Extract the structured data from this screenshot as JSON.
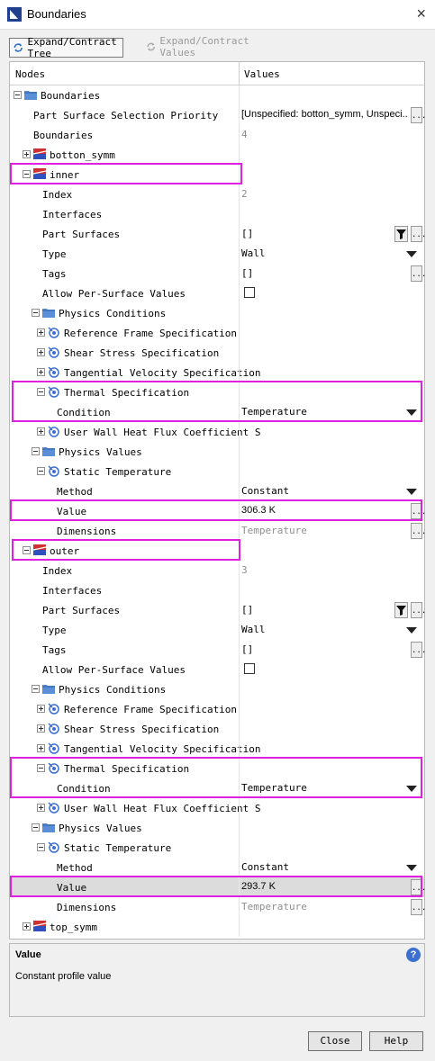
{
  "window": {
    "title": "Boundaries",
    "close_glyph": "×"
  },
  "toolbar": {
    "expand_tree": "Expand/Contract Tree",
    "expand_values": "Expand/Contract Values"
  },
  "columns": {
    "nodes": "Nodes",
    "values": "Values"
  },
  "rows": [
    {
      "name": "Boundaries",
      "value": "",
      "level": 0,
      "expander": "minus",
      "icon": "folder-icon"
    },
    {
      "name": "Part Surface Selection Priority",
      "value": "[Unspecified: botton_symm, Unspeci...",
      "level": 1,
      "value_font": "sans",
      "dots": true
    },
    {
      "name": "Boundaries",
      "value": "4",
      "level": 1,
      "value_color": "gray"
    },
    {
      "name": "botton_symm",
      "value": "",
      "level": 1,
      "expander": "plus",
      "icon": "boundary-icon"
    },
    {
      "name": "inner",
      "value": "",
      "level": 1,
      "expander": "minus",
      "icon": "boundary-icon"
    },
    {
      "name": "Index",
      "value": "2",
      "level": 2,
      "value_color": "gray"
    },
    {
      "name": "Interfaces",
      "value": "",
      "level": 2
    },
    {
      "name": "Part Surfaces",
      "value": "[]",
      "level": 2,
      "filter": true,
      "dots": true
    },
    {
      "name": "Type",
      "value": "Wall",
      "level": 2,
      "dropdown": true
    },
    {
      "name": "Tags",
      "value": "[]",
      "level": 2,
      "dots": true
    },
    {
      "name": "Allow Per-Surface Values",
      "value": "",
      "level": 2,
      "checkbox": true
    },
    {
      "name": "Physics Conditions",
      "value": "",
      "level": 2,
      "expander": "minus",
      "icon": "folder-icon"
    },
    {
      "name": "Reference Frame Specification",
      "value": "",
      "level": 3,
      "expander": "plus",
      "icon": "physics-icon"
    },
    {
      "name": "Shear Stress Specification",
      "value": "",
      "level": 3,
      "expander": "plus",
      "icon": "physics-icon"
    },
    {
      "name": "Tangential Velocity Specification",
      "value": "",
      "level": 3,
      "expander": "plus",
      "icon": "physics-icon"
    },
    {
      "name": "Thermal Specification",
      "value": "",
      "level": 3,
      "expander": "minus",
      "icon": "physics-icon"
    },
    {
      "name": "Condition",
      "value": "Temperature",
      "level": 4,
      "dropdown": true
    },
    {
      "name": "User Wall Heat Flux Coefficient S",
      "value": "",
      "level": 3,
      "expander": "plus",
      "icon": "physics-icon"
    },
    {
      "name": "Physics Values",
      "value": "",
      "level": 2,
      "expander": "minus",
      "icon": "folder-icon"
    },
    {
      "name": "Static Temperature",
      "value": "",
      "level": 3,
      "expander": "minus",
      "icon": "physics-icon"
    },
    {
      "name": "Method",
      "value": "Constant",
      "level": 4,
      "dropdown": true
    },
    {
      "name": "Value",
      "value": "306.3 K",
      "level": 4,
      "dots": true,
      "value_font": "sans"
    },
    {
      "name": "Dimensions",
      "value": "Temperature",
      "level": 4,
      "value_color": "gray",
      "dots": true
    },
    {
      "name": "outer",
      "value": "",
      "level": 1,
      "expander": "minus",
      "icon": "boundary-icon"
    },
    {
      "name": "Index",
      "value": "3",
      "level": 2,
      "value_color": "gray"
    },
    {
      "name": "Interfaces",
      "value": "",
      "level": 2
    },
    {
      "name": "Part Surfaces",
      "value": "[]",
      "level": 2,
      "filter": true,
      "dots": true
    },
    {
      "name": "Type",
      "value": "Wall",
      "level": 2,
      "dropdown": true
    },
    {
      "name": "Tags",
      "value": "[]",
      "level": 2,
      "dots": true
    },
    {
      "name": "Allow Per-Surface Values",
      "value": "",
      "level": 2,
      "checkbox": true
    },
    {
      "name": "Physics Conditions",
      "value": "",
      "level": 2,
      "expander": "minus",
      "icon": "folder-icon"
    },
    {
      "name": "Reference Frame Specification",
      "value": "",
      "level": 3,
      "expander": "plus",
      "icon": "physics-icon"
    },
    {
      "name": "Shear Stress Specification",
      "value": "",
      "level": 3,
      "expander": "plus",
      "icon": "physics-icon"
    },
    {
      "name": "Tangential Velocity Specification",
      "value": "",
      "level": 3,
      "expander": "plus",
      "icon": "physics-icon"
    },
    {
      "name": "Thermal Specification",
      "value": "",
      "level": 3,
      "expander": "minus",
      "icon": "physics-icon"
    },
    {
      "name": "Condition",
      "value": "Temperature",
      "level": 4,
      "dropdown": true
    },
    {
      "name": "User Wall Heat Flux Coefficient S",
      "value": "",
      "level": 3,
      "expander": "plus",
      "icon": "physics-icon"
    },
    {
      "name": "Physics Values",
      "value": "",
      "level": 2,
      "expander": "minus",
      "icon": "folder-icon"
    },
    {
      "name": "Static Temperature",
      "value": "",
      "level": 3,
      "expander": "minus",
      "icon": "physics-icon"
    },
    {
      "name": "Method",
      "value": "Constant",
      "level": 4,
      "dropdown": true
    },
    {
      "name": "Value",
      "value": "293.7 K",
      "level": 4,
      "dots": true,
      "value_font": "sans",
      "selected": true
    },
    {
      "name": "Dimensions",
      "value": "Temperature",
      "level": 4,
      "value_color": "gray",
      "dots": true
    },
    {
      "name": "top_symm",
      "value": "",
      "level": 1,
      "expander": "plus",
      "icon": "boundary-icon"
    }
  ],
  "description": {
    "title": "Value",
    "text": "Constant profile value",
    "help_glyph": "?"
  },
  "buttons": {
    "close": "Close",
    "help": "Help"
  },
  "colors": {
    "highlight": "#e020e0",
    "folder": "#5a8fd8",
    "boundary_red": "#d03030",
    "boundary_blue": "#3050c0"
  }
}
